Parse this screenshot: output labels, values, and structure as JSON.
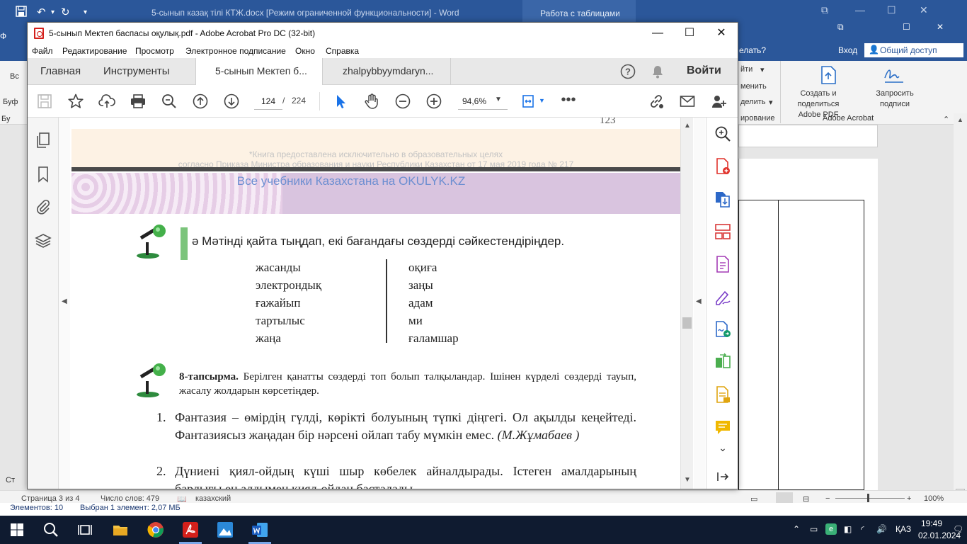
{
  "word": {
    "title": "5-сынып казақ тілі КТЖ.docx [Режим ограниченной функциональности] - Word",
    "context_tab": "Работа с таблицами",
    "login": "Вход",
    "share": "Общий доступ",
    "tell_me": "елать?",
    "ribbon": {
      "left_cut_1": "йти",
      "left_cut_2": "менить",
      "left_cut_3": "делить",
      "left_cut_group": "ирование",
      "create_share_pdf": "Создать и поделиться Adobe PDF",
      "request_sign": "Запросить подписи",
      "group_adobe": "Adobe Acrobat"
    },
    "left_cut": [
      "Ф",
      "Вс",
      "Буф",
      "Бу",
      "Ст"
    ],
    "status": {
      "page": "Страница 3 из 4",
      "words": "Число слов: 479",
      "lang": "казахский",
      "zoom": "100%"
    },
    "explorer_status": {
      "items": "Элементов: 10",
      "selected": "Выбран 1 элемент: 2,07 МБ"
    }
  },
  "acrobat": {
    "title": "5-сынып Мектеп баспасы оқулық.pdf - Adobe Acrobat Pro DC (32-bit)",
    "menu": [
      "Файл",
      "Редактирование",
      "Просмотр",
      "Электронное подписание",
      "Окно",
      "Справка"
    ],
    "tabs": {
      "home": "Главная",
      "tools": "Инструменты",
      "doc1": "5-сынып Мектеп б...",
      "doc2": "zhalpybbyymdaryn...",
      "signin": "Войти"
    },
    "toolbar": {
      "page_current": "124",
      "page_sep": "/",
      "page_total": "224",
      "zoom": "94,6%"
    }
  },
  "pdf": {
    "page_number": "123",
    "disclaimer_1": "*Книга предоставлена исключительно в образовательных целях",
    "disclaimer_2": "согласно Приказа Министра образования и науки Республики Казахстан от 17 мая 2019 года № 217",
    "watermark": "Все учебники Казахстана на OKULYK.KZ",
    "task_title": "ә Мәтінді қайта тыңдап, екі бағандағы сөздерді сәйкестендіріңдер.",
    "left_words": [
      "жасанды",
      "электрондық",
      "ғажайып",
      "тартылыс",
      "жаңа"
    ],
    "right_words": [
      "оқиға",
      "заңы",
      "адам",
      "ми",
      "ғаламшар"
    ],
    "task8_label": "8-тапсырма.",
    "task8_text": "Берілген қанатты сөздерді топ болып талқыландар. Ішінен күрделі сөздерді тауып, жасалу жолдарын көрсетіңдер.",
    "item1_num": "1.",
    "item1_text": "Фантазия – өмірдің гүлді, көрікті болуының түпкі діңгегі. Ол ақылды кеңейтеді. Фантазиясыз жаңадан бір нәрсені ойлап табу мүмкін емес.",
    "item1_author": "(М.Жұмабаев )",
    "item2_num": "2.",
    "item2_text": "Дүниені қиял-ойдың күші шыр көбелек айналдырады. Істеген амалдарының барлығы ең алдымен қиял-ойдан басталады."
  },
  "taskbar": {
    "lang": "ҚАЗ",
    "time": "19:49",
    "date": "02.01.2024"
  }
}
